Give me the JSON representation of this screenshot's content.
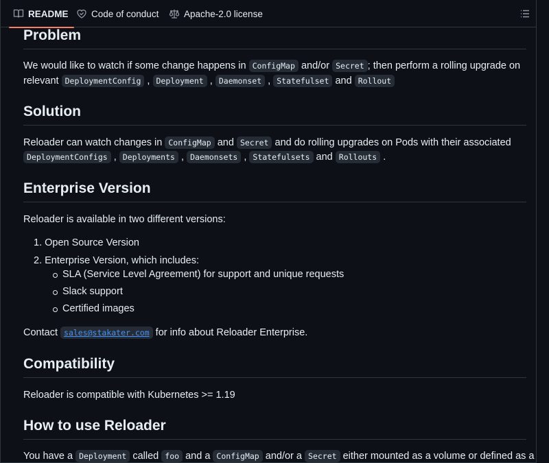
{
  "tabs": [
    {
      "label": "README",
      "icon": "book-icon",
      "active": true
    },
    {
      "label": "Code of conduct",
      "icon": "heart-icon",
      "active": false
    },
    {
      "label": "Apache-2.0 license",
      "icon": "law-icon",
      "active": false
    }
  ],
  "toc_icon": "list-unordered-icon",
  "sections": {
    "problem": {
      "heading": "Problem",
      "line1_prefix": "We would like to watch if some change happens in",
      "code_configmap": "ConfigMap",
      "andor": "and/or",
      "code_secret": "Secret",
      "line1_suffix": "; then perform a rolling upgrade on",
      "line2_prefix": "relevant",
      "code_deploymentconfig": "DeploymentConfig",
      "code_deployment": "Deployment",
      "code_daemonset": "Daemonset",
      "code_statefulset": "Statefulset",
      "and": "and",
      "code_rollout": "Rollout"
    },
    "solution": {
      "heading": "Solution",
      "line1_prefix": "Reloader can watch changes in",
      "code_configmap": "ConfigMap",
      "and": "and",
      "code_secret": "Secret",
      "line1_suffix": "and do rolling upgrades on Pods with their associated",
      "code_deploymentconfigs": "DeploymentConfigs",
      "code_deployments": "Deployments",
      "code_daemonsets": "Daemonsets",
      "code_statefulsets": "Statefulsets",
      "and2": "and",
      "code_rollouts": "Rollouts",
      "period": "."
    },
    "enterprise": {
      "heading": "Enterprise Version",
      "intro": "Reloader is available in two different versions:",
      "items": [
        "1. Open Source Version",
        "2. Enterprise Version, which includes:"
      ],
      "subitems": [
        "SLA (Service Level Agreement) for support and unique requests",
        "Slack support",
        "Certified images"
      ],
      "contact_prefix": "Contact",
      "email": "sales@stakater.com",
      "contact_suffix": "for info about Reloader Enterprise."
    },
    "compatibility": {
      "heading": "Compatibility",
      "text": "Reloader is compatible with Kubernetes >= 1.19"
    },
    "howto": {
      "heading": "How to use Reloader",
      "prefix": "You have a",
      "code_deployment": "Deployment",
      "called": "called",
      "code_foo": "foo",
      "and_a": "and a",
      "code_configmap": "ConfigMap",
      "andor_a": "and/or a",
      "code_secret": "Secret",
      "suffix": "either mounted as a volume or defined as a"
    }
  },
  "colors": {
    "background": "#0d1117",
    "text": "#e6edf3",
    "border": "#30363d",
    "code_bg": "#262c36",
    "link": "#4493f8",
    "active_tab_underline": "#f78166"
  }
}
